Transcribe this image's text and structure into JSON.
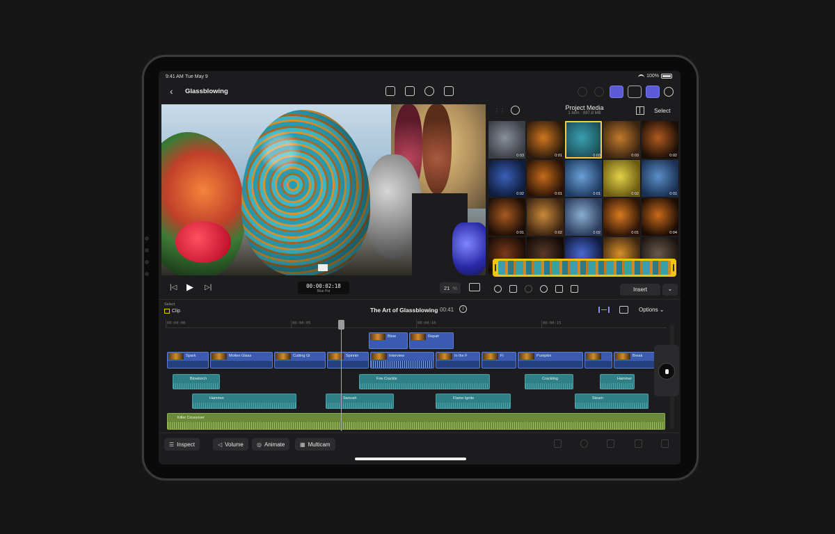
{
  "status": {
    "time": "9:41 AM",
    "date": "Tue May 9",
    "battery": "100%"
  },
  "toolbar": {
    "back_icon": "chevron-left-icon",
    "project_title": "Glassblowing"
  },
  "viewer": {
    "timecode": "00:00:02:18",
    "clip_name": "Blue Pot",
    "zoom_value": "21",
    "zoom_unit": "%"
  },
  "browser": {
    "title": "Project Media",
    "subtitle": "1 item · 887.8 MB",
    "select_label": "Select",
    "insert_label": "Insert",
    "thumbnails": [
      {
        "dur": "0:03"
      },
      {
        "dur": "0:01"
      },
      {
        "dur": "0:03"
      },
      {
        "dur": "0:03"
      },
      {
        "dur": "0:02"
      },
      {
        "dur": "0:02"
      },
      {
        "dur": "0:01"
      },
      {
        "dur": "0:01"
      },
      {
        "dur": "0:02"
      },
      {
        "dur": "0:01"
      },
      {
        "dur": "0:01"
      },
      {
        "dur": "0:02"
      },
      {
        "dur": "0:02"
      },
      {
        "dur": "0:01"
      },
      {
        "dur": "0:04"
      },
      {
        "dur": ""
      },
      {
        "dur": ""
      },
      {
        "dur": ""
      },
      {
        "dur": ""
      },
      {
        "dur": ""
      }
    ]
  },
  "timeline_header": {
    "select_label": "Select",
    "clip_label": "Clip",
    "title": "The Art of Glassblowing",
    "duration": "00:41",
    "options_label": "Options"
  },
  "ruler": [
    "00:00:00",
    "00:00:05",
    "00:00:10",
    "00:00:15"
  ],
  "clips": {
    "connected": [
      "Blow",
      "Repair"
    ],
    "primary": [
      "Spark",
      "Molten Glass",
      "Cutting Gl",
      "Spinnin",
      "Interview",
      "In the F",
      "Fi",
      "Pumpkin",
      "",
      "Break"
    ],
    "audio1": [
      "Blowtorch",
      "Fire Crackle",
      "Crackling",
      "Hammer"
    ],
    "audio2": [
      "Hammer",
      "Swoosh",
      "Flame Ignite",
      "Steam"
    ],
    "music": "Killer Crossover"
  },
  "bottombar": {
    "inspect": "Inspect",
    "volume": "Volume",
    "animate": "Animate",
    "multicam": "Multicam"
  }
}
